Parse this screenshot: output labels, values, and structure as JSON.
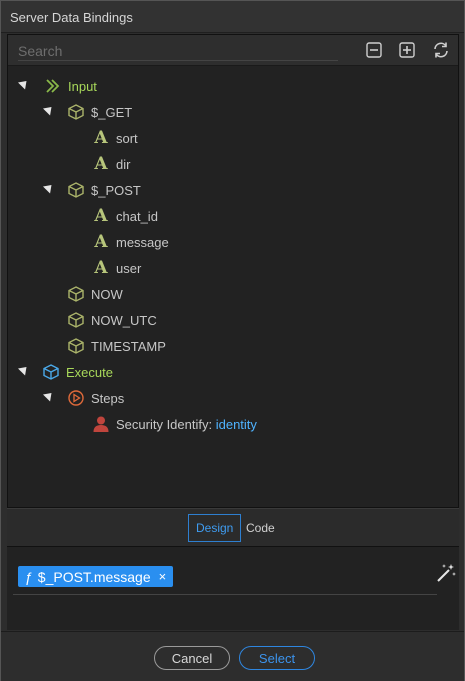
{
  "window": {
    "title": "Server Data Bindings"
  },
  "search": {
    "placeholder": "Search"
  },
  "toolbar": {
    "collapse_icon": "collapse-all-icon",
    "expand_icon": "expand-all-icon",
    "refresh_icon": "refresh-icon"
  },
  "tree": {
    "input": {
      "label": "Input"
    },
    "get": {
      "label": "$_GET",
      "children": [
        "sort",
        "dir"
      ]
    },
    "post": {
      "label": "$_POST",
      "children": [
        "chat_id",
        "message",
        "user"
      ]
    },
    "now": {
      "label": "NOW"
    },
    "now_utc": {
      "label": "NOW_UTC"
    },
    "timestamp": {
      "label": "TIMESTAMP"
    },
    "execute": {
      "label": "Execute"
    },
    "steps": {
      "label": "Steps"
    },
    "security": {
      "label": "Security Identify: ",
      "value": "identity"
    }
  },
  "tabs": {
    "design": "Design",
    "code": "Code"
  },
  "expression": {
    "chip_prefix": "ƒ",
    "chip_label": "$_POST.message",
    "chip_remove": "×"
  },
  "footer": {
    "cancel": "Cancel",
    "select": "Select"
  },
  "colors": {
    "accent": "#2a8ff0",
    "green_label": "#a8d85a",
    "link": "#4fb3ff"
  }
}
